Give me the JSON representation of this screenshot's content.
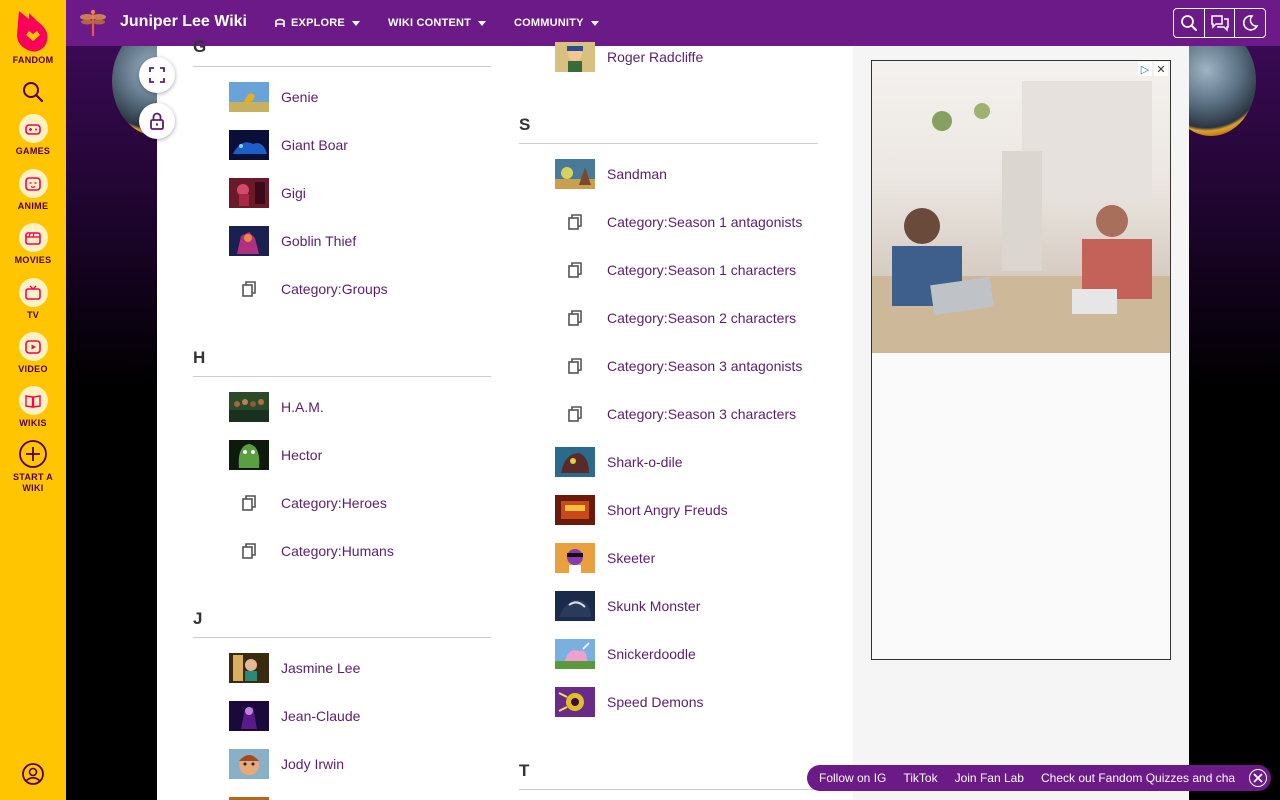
{
  "rail": {
    "brand": "FANDOM",
    "items": [
      {
        "label": "GAMES",
        "icon": "gamepad-icon"
      },
      {
        "label": "ANIME",
        "icon": "anime-face-icon"
      },
      {
        "label": "MOVIES",
        "icon": "clapperboard-icon"
      },
      {
        "label": "TV",
        "icon": "tv-icon"
      },
      {
        "label": "VIDEO",
        "icon": "video-play-icon"
      },
      {
        "label": "WIKIS",
        "icon": "open-book-icon"
      }
    ],
    "start_wiki": "START A WIKI"
  },
  "header": {
    "wiki_title": "Juniper Lee Wiki",
    "nav": [
      "EXPLORE",
      "WIKI CONTENT",
      "COMMUNITY"
    ]
  },
  "colors": {
    "brand_purple": "#6c1a87",
    "fandom_yellow": "#ffc500",
    "link": "#5a1f6b"
  },
  "left_column": {
    "sections": [
      {
        "letter": "G",
        "entries": [
          {
            "text": "Genie",
            "kind": "page"
          },
          {
            "text": "Giant Boar",
            "kind": "page"
          },
          {
            "text": "Gigi",
            "kind": "page"
          },
          {
            "text": "Goblin Thief",
            "kind": "page"
          },
          {
            "text": "Category:Groups",
            "kind": "category"
          }
        ]
      },
      {
        "letter": "H",
        "entries": [
          {
            "text": "H.A.M.",
            "kind": "page"
          },
          {
            "text": "Hector",
            "kind": "page"
          },
          {
            "text": "Category:Heroes",
            "kind": "category"
          },
          {
            "text": "Category:Humans",
            "kind": "category"
          }
        ]
      },
      {
        "letter": "J",
        "entries": [
          {
            "text": "Jasmine Lee",
            "kind": "page"
          },
          {
            "text": "Jean-Claude",
            "kind": "page"
          },
          {
            "text": "Jody Irwin",
            "kind": "page"
          }
        ]
      }
    ]
  },
  "right_column": {
    "top_entry": {
      "text": "Roger Radcliffe",
      "kind": "page"
    },
    "sections": [
      {
        "letter": "S",
        "entries": [
          {
            "text": "Sandman",
            "kind": "page"
          },
          {
            "text": "Category:Season 1 antagonists",
            "kind": "category"
          },
          {
            "text": "Category:Season 1 characters",
            "kind": "category"
          },
          {
            "text": "Category:Season 2 characters",
            "kind": "category"
          },
          {
            "text": "Category:Season 3 antagonists",
            "kind": "category"
          },
          {
            "text": "Category:Season 3 characters",
            "kind": "category"
          },
          {
            "text": "Shark-o-dile",
            "kind": "page"
          },
          {
            "text": "Short Angry Freuds",
            "kind": "page"
          },
          {
            "text": "Skeeter",
            "kind": "page"
          },
          {
            "text": "Skunk Monster",
            "kind": "page"
          },
          {
            "text": "Snickerdoodle",
            "kind": "page"
          },
          {
            "text": "Speed Demons",
            "kind": "page"
          }
        ]
      },
      {
        "letter": "T",
        "entries": []
      }
    ]
  },
  "social_bar": {
    "items": [
      "Follow on IG",
      "TikTok",
      "Join Fan Lab",
      "Check out Fandom Quizzes and cha"
    ]
  }
}
